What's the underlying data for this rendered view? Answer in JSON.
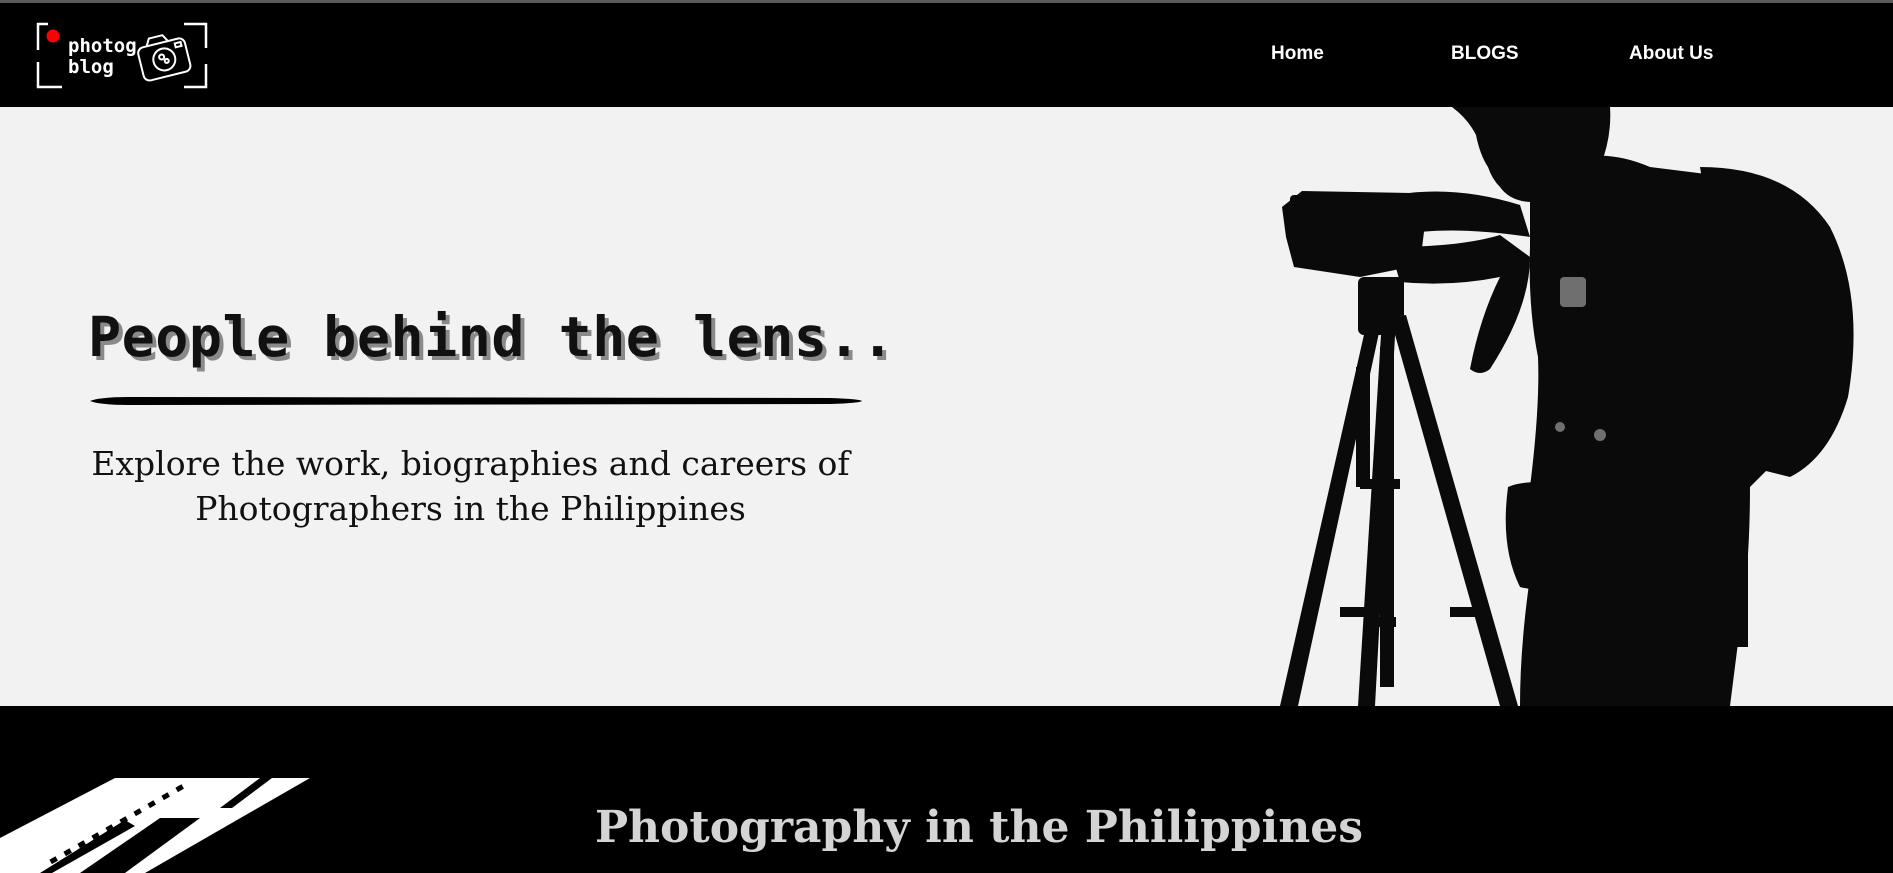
{
  "logo": {
    "line1": "photog",
    "line2": "blog",
    "icon": "camera-icon",
    "dot_color": "#ff0000"
  },
  "nav": {
    "items": [
      {
        "label": "Home"
      },
      {
        "label": "BLOGS"
      },
      {
        "label": "About Us"
      }
    ]
  },
  "hero": {
    "title": "People behind the lens..",
    "subtitle": "Explore the work, biographies and careers of Photographers in the Philippines",
    "image": "photographer-silhouette"
  },
  "section": {
    "title": "Photography in the Philippines",
    "image": "film-strip"
  },
  "colors": {
    "nav_bg": "#000000",
    "hero_bg": "#f2f2f2",
    "text_dark": "#111111",
    "section_title": "#d4d4d4"
  }
}
